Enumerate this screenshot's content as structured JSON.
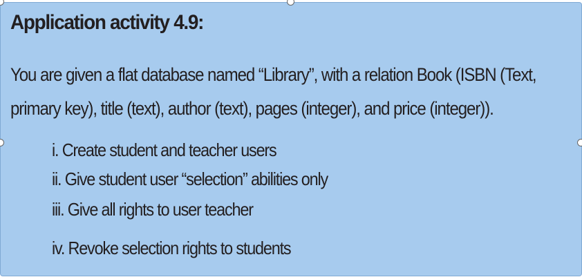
{
  "activity": {
    "heading": "Application activity 4.9:",
    "paragraph_line_1": "You are given a flat database named “Library”, with a relation Book (ISBN (Text,",
    "paragraph_line_2": "primary key), title (text), author (text), pages (integer), and price (integer)).",
    "items": [
      "i. Create student and teacher users",
      "ii.  Give student user “selection” abilities only",
      "iii. Give all rights to user teacher",
      "iv. Revoke selection rights to students"
    ]
  },
  "colors": {
    "box_background": "#a7cbee",
    "text": "#231f20"
  }
}
